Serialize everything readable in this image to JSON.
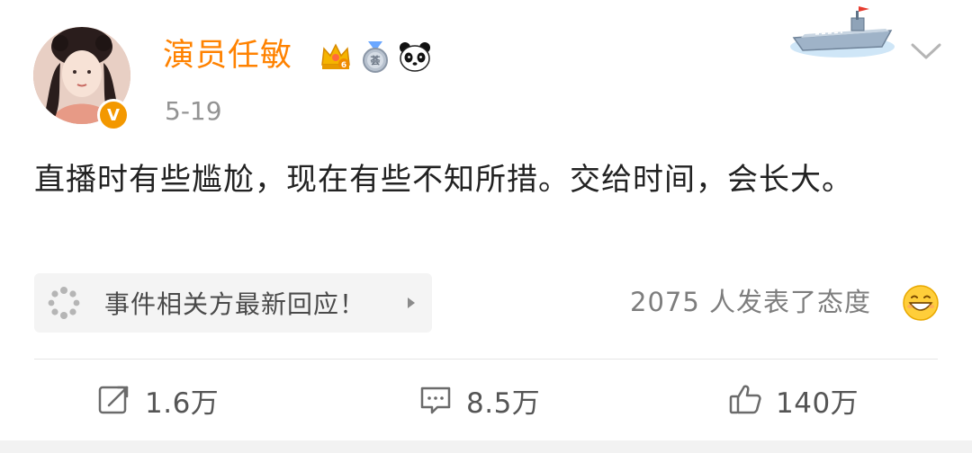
{
  "author": {
    "name": "演员任敏",
    "verified_mark": "V",
    "badges": [
      "crown-badge-icon",
      "medal-badge-icon",
      "panda-badge-icon"
    ]
  },
  "post": {
    "date": "5-19",
    "text": "直播时有些尴尬，现在有些不知所措。交给时间，会长大。"
  },
  "event_card": {
    "label": "事件相关方最新回应！",
    "icon": "spinner-icon"
  },
  "attitude": {
    "text": "2075 人发表了态度",
    "emoji": "grinning-emoji"
  },
  "actions": {
    "repost_count": "1.6万",
    "comment_count": "8.5万",
    "like_count": "140万"
  },
  "colors": {
    "username": "#ff8200",
    "date": "#939393",
    "body_text": "#222222",
    "verified": "#f39800",
    "divider": "#e6e6e6"
  }
}
